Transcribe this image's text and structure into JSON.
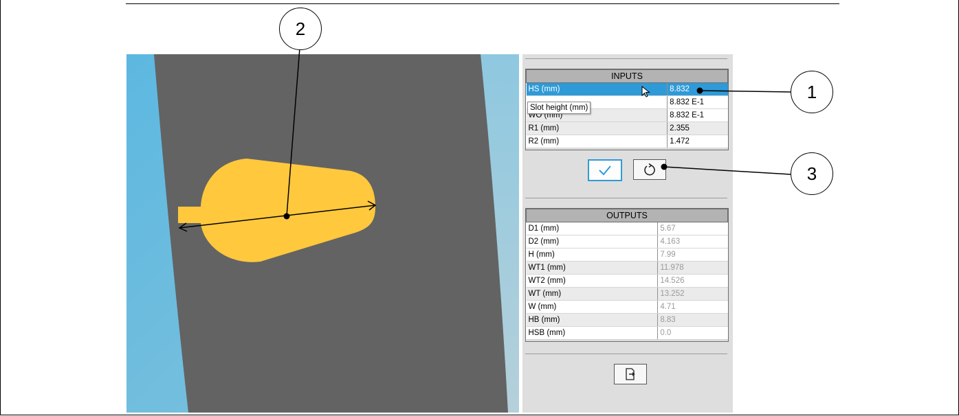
{
  "inputs": {
    "header": "INPUTS",
    "rows": [
      {
        "label": "HS (mm)",
        "value": "8.832"
      },
      {
        "label": "",
        "value": "8.832 E-1"
      },
      {
        "label": "WO (mm)",
        "value": "8.832 E-1"
      },
      {
        "label": "R1 (mm)",
        "value": "2.355"
      },
      {
        "label": "R2 (mm)",
        "value": "1.472"
      }
    ]
  },
  "tooltip": "Slot height (mm)",
  "outputs": {
    "header": "OUTPUTS",
    "rows": [
      {
        "label": "D1 (mm)",
        "value": "5.67"
      },
      {
        "label": "D2 (mm)",
        "value": "4.163"
      },
      {
        "label": "H (mm)",
        "value": "7.99"
      },
      {
        "label": "WT1 (mm)",
        "value": "11.978"
      },
      {
        "label": "WT2 (mm)",
        "value": "14.526"
      },
      {
        "label": "WT (mm)",
        "value": "13.252"
      },
      {
        "label": "W (mm)",
        "value": "4.71"
      },
      {
        "label": "HB (mm)",
        "value": "8.83"
      },
      {
        "label": "HSB (mm)",
        "value": "0.0"
      }
    ]
  },
  "buttons": {
    "apply_icon": "checkmark-icon",
    "reset_icon": "reset-icon",
    "export_icon": "export-icon"
  },
  "callouts": {
    "c1": "1",
    "c2": "2",
    "c3": "3"
  },
  "colors": {
    "selection": "#2f9ad8",
    "slot": "#ffc83d",
    "core": "#636363",
    "airgap": "#5ab5dc"
  }
}
